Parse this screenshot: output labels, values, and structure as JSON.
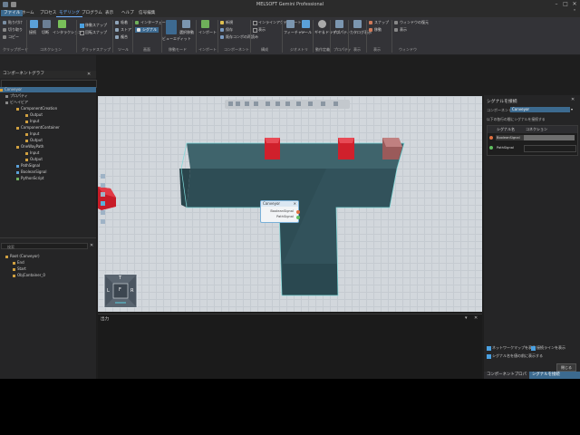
{
  "window": {
    "title": "MELSOFT Gemini Professional",
    "minimize": "–",
    "maximize": "□",
    "close": "✕"
  },
  "menu": {
    "items": [
      "ファイル",
      "ホーム",
      "プロセス",
      "モデリング",
      "プログラム",
      "表示",
      "ヘルプ",
      "信号編集"
    ],
    "active_index": 0,
    "selected_index": 3
  },
  "ribbon": {
    "clipboard": {
      "group": "クリップボード",
      "items": [
        "貼り付け",
        "切り取り",
        "コピー"
      ]
    },
    "connection": {
      "group": "コネクション",
      "items": [
        "接続",
        "切断",
        "インタラクション"
      ]
    },
    "gridsnap": {
      "group": "グリッドスナップ",
      "items": [
        "移動スナップ",
        "回転スナップ"
      ]
    },
    "tool": {
      "group": "ツール",
      "items": [
        "吸着",
        "ストア",
        "複合"
      ]
    },
    "display": {
      "group": "画面",
      "items": [
        "インターフェース",
        "シグナル"
      ]
    },
    "movemode": {
      "group": "移動モード",
      "items": [
        "ビューエディット",
        "選択移動"
      ]
    },
    "import": {
      "group": "インポート",
      "items": [
        "インポート"
      ]
    },
    "component": {
      "group": "コンポーネント",
      "items": [
        "新規",
        "保存",
        "既存コンポの再読み"
      ]
    },
    "edit": {
      "group": "構成",
      "items": [
        "インラインアクティベート",
        "表示"
      ]
    },
    "geometry": {
      "group": "ジオメトリ",
      "items": [
        "フィーチャー",
        "ツール"
      ]
    },
    "motion": {
      "group": "動作定義",
      "items": [
        "ギヤ＆ドライブ"
      ]
    },
    "property": {
      "group": "プロパティ",
      "items": [
        "プロパティ"
      ]
    },
    "display2": {
      "group": "表示",
      "items": [
        "カタログ表示"
      ]
    },
    "snap": {
      "group": "表示",
      "items": [
        "スナップ",
        "移動"
      ]
    },
    "window": {
      "group": "ウィンドウ",
      "items": [
        "ウィンドウの復元",
        "表示"
      ]
    }
  },
  "left_panel": {
    "title": "コンポーネントグラフ",
    "tree": [
      "Conveyor",
      "プロパティ",
      "ビヘイビア",
      "ComponentCreation",
      "Output",
      "Input",
      "ComponentContainer",
      "Input",
      "Output",
      "OneWayPath",
      "Input",
      "Output",
      "PathSignal",
      "BooleanSignal",
      "PythonScript"
    ],
    "search_placeholder": "検索",
    "tree2": [
      "Root (Conveyor)",
      "End",
      "Start",
      "ObjContainer_0"
    ]
  },
  "viewport": {
    "node_title": "Conveyor",
    "node_ports": [
      "BooleanSignal",
      "PathSignal"
    ],
    "navcube": {
      "top": "T",
      "left": "L",
      "right": "R",
      "bottom": "F"
    }
  },
  "output_panel": {
    "title": "出力"
  },
  "right_panel": {
    "title": "シグナルを接続",
    "component_label": "コンポーネント",
    "component_value": "Conveyor",
    "hint": "以下の各行の間にシグナルを接続する",
    "col_signal": "シグナル名",
    "col_connection": "コネクション",
    "rows": [
      "BooleanSignal",
      "PathSignal"
    ],
    "opt1": "ネットワークマップを表示",
    "opt2": "接続ラインを表示",
    "opt3": "シグナル名を値の前に表示する",
    "close_button": "閉じる",
    "tab1": "コンポーネントプロパティ",
    "tab2": "シグナルを接続"
  },
  "colors": {
    "conveyor": "#2f4f57",
    "red_part": "#d0202c",
    "accent": "#3c6a8f"
  }
}
